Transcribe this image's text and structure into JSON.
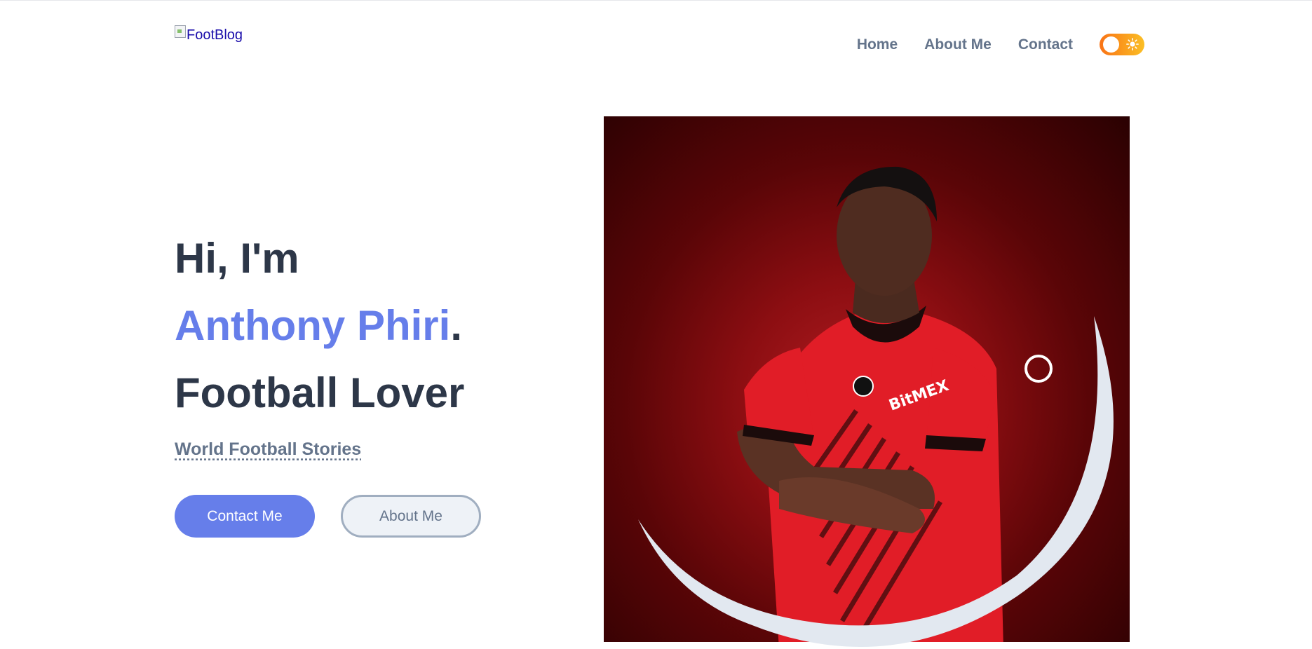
{
  "header": {
    "logo_alt": "FootBlog",
    "nav": [
      "Home",
      "About Me",
      "Contact"
    ],
    "theme_toggle_icon": "sun-icon"
  },
  "hero": {
    "greeting": "Hi, I'm",
    "name": "Anthony Phiri",
    "name_suffix": ".",
    "role": "Football Lover",
    "tagline": "World Football Stories",
    "buttons": {
      "contact": "Contact Me",
      "about": "About Me"
    }
  },
  "colors": {
    "accent": "#667eea",
    "heading": "#2d3748",
    "muted": "#64748b",
    "toggle_start": "#f97316",
    "toggle_end": "#fbbf24"
  }
}
